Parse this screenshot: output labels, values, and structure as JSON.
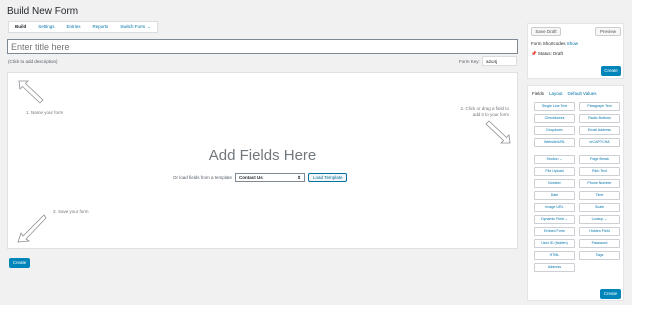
{
  "page": {
    "title": "Build New Form"
  },
  "tabs": [
    {
      "label": "Build",
      "active": true
    },
    {
      "label": "Settings"
    },
    {
      "label": "Entries"
    },
    {
      "label": "Reports"
    },
    {
      "label": "Switch Form",
      "icon": "chevron-down-icon"
    }
  ],
  "form": {
    "title_placeholder": "Enter title here",
    "description_hint": "(Click to add description)",
    "form_key_label": "Form Key:",
    "form_key_value": "a2u4j"
  },
  "canvas": {
    "step1": "1. Name your form",
    "step2_line1": "2. Click or drag a field to",
    "step2_line2": "add it to your form",
    "step3": "3. Save your form",
    "heading": "Add Fields Here",
    "template_label": "Or load fields from a template",
    "template_selected": "Contact Us",
    "load_template": "Load Template"
  },
  "bottom": {
    "create": "Create"
  },
  "publish": {
    "save_draft": "Save Draft",
    "preview": "Preview",
    "shortcodes_label": "Form Shortcodes",
    "show_link": "Show",
    "status": "Status: Draft",
    "create": "Create"
  },
  "fields_panel": {
    "tabs": [
      "Fields",
      "Layout",
      "Default Values"
    ],
    "group1": [
      "Single Line Text",
      "Paragraph Text",
      "Checkboxes",
      "Radio Buttons",
      "Dropdown",
      "Email Address",
      "Website/URL",
      "reCAPTCHA"
    ],
    "group2": [
      "Section",
      "Page Break",
      "File Upload",
      "Rich Text",
      "Number",
      "Phone Number",
      "Date",
      "Time",
      "Image URL",
      "Scale",
      "Dynamic Field",
      "Lookup",
      "Embed Form",
      "Hidden Field",
      "User ID (hidden)",
      "Password",
      "HTML",
      "Tags",
      "Address"
    ],
    "create": "Create"
  },
  "colors": {
    "accent": "#0085ba",
    "link": "#0073aa",
    "background": "#f1f1f1"
  }
}
